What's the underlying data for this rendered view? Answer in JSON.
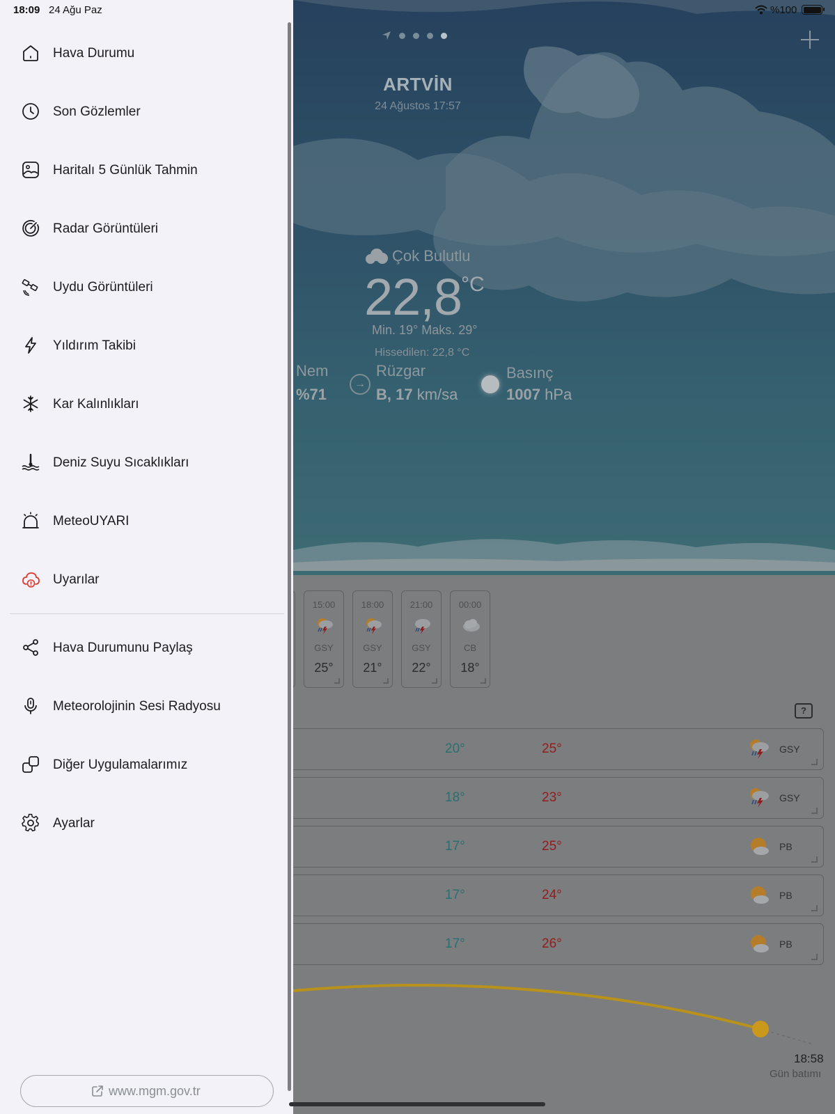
{
  "status_bar": {
    "time": "18:09",
    "date": "24 Ağu Paz",
    "battery": "%100"
  },
  "drawer": {
    "items": [
      {
        "label": "Hava Durumu",
        "icon": "home-icon"
      },
      {
        "label": "Son Gözlemler",
        "icon": "clock-icon"
      },
      {
        "label": "Haritalı 5 Günlük Tahmin",
        "icon": "image-icon"
      },
      {
        "label": "Radar Görüntüleri",
        "icon": "radar-icon"
      },
      {
        "label": "Uydu Görüntüleri",
        "icon": "satellite-icon"
      },
      {
        "label": "Yıldırım Takibi",
        "icon": "lightning-icon"
      },
      {
        "label": "Kar Kalınlıkları",
        "icon": "snowflake-icon"
      },
      {
        "label": "Deniz Suyu Sıcaklıkları",
        "icon": "sea-thermometer-icon"
      },
      {
        "label": "MeteoUYARI",
        "icon": "alarm-icon"
      },
      {
        "label": "Uyarılar",
        "icon": "warning-cloud-icon",
        "color": "#e0362c"
      }
    ],
    "secondary_items": [
      {
        "label": "Hava Durumunu Paylaş",
        "icon": "share-icon"
      },
      {
        "label": "Meteorolojinin Sesi Radyosu",
        "icon": "microphone-icon"
      },
      {
        "label": "Diğer Uygulamalarımız",
        "icon": "apps-icon"
      },
      {
        "label": "Ayarlar",
        "icon": "gear-icon"
      }
    ],
    "website": "www.mgm.gov.tr"
  },
  "weather": {
    "city": "ARTVİN",
    "updated": "24 Ağustos 17:57",
    "condition": "Çok Bulutlu",
    "temperature": "22,8",
    "unit": "°C",
    "min_max": "Min. 19°  Maks. 29°",
    "feels_like": "Hissedilen: 22,8 °C",
    "page_count": 4,
    "active_page": 4,
    "humidity": {
      "label": "Nem",
      "value": "%71"
    },
    "wind": {
      "label": "Rüzgar",
      "value": "B, 17",
      "unit": "km/sa"
    },
    "pressure": {
      "label": "Basınç",
      "value": "1007",
      "unit": "hPa"
    }
  },
  "hourly": [
    {
      "time": "15:00",
      "code": "GSY",
      "temp": "25°",
      "icon": "thunder-rain-icon"
    },
    {
      "time": "18:00",
      "code": "GSY",
      "temp": "21°",
      "icon": "thunder-rain-icon"
    },
    {
      "time": "21:00",
      "code": "GSY",
      "temp": "22°",
      "icon": "thunder-rain-icon"
    },
    {
      "time": "00:00",
      "code": "CB",
      "temp": "18°",
      "icon": "cloud-icon"
    }
  ],
  "daily": [
    {
      "min": "20°",
      "max": "25°",
      "code": "GSY",
      "icon": "thunder-rain-icon"
    },
    {
      "min": "18°",
      "max": "23°",
      "code": "GSY",
      "icon": "thunder-rain-icon"
    },
    {
      "min": "17°",
      "max": "25°",
      "code": "PB",
      "icon": "partly-cloudy-icon"
    },
    {
      "min": "17°",
      "max": "24°",
      "code": "PB",
      "icon": "partly-cloudy-icon"
    },
    {
      "min": "17°",
      "max": "26°",
      "code": "PB",
      "icon": "partly-cloudy-icon"
    }
  ],
  "sun": {
    "sunset_time": "18:58",
    "sunset_label": "Gün batımı"
  },
  "colors": {
    "drawer_bg": "#f3f2f9",
    "alert_red": "#e0362c",
    "min_temp": "#2a6f70",
    "max_temp": "#8f1e1e",
    "sun_arc": "#b8921a"
  }
}
